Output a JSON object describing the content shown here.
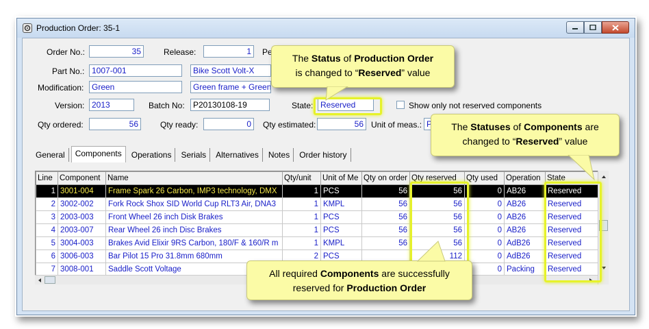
{
  "window": {
    "title": "Production Order: 35-1",
    "controls": {
      "minimize": "minimize",
      "maximize": "maximize",
      "close": "close"
    }
  },
  "form": {
    "order_no_label": "Order No.:",
    "order_no": "35",
    "release_label": "Release:",
    "release": "1",
    "period_label": "Per",
    "part_no_label": "Part No.:",
    "part_no": "1007-001",
    "part_name": "Bike Scott Volt-X",
    "modification_label": "Modification:",
    "modification": "Green",
    "modification_desc": "Green frame + Green fork",
    "version_label": "Version:",
    "version": "2013",
    "batch_no_label": "Batch No:",
    "batch_no": "P20130108-19",
    "state_label": "State:",
    "state": "Reserved",
    "show_only_label": "Show only not reserved components",
    "qty_ordered_label": "Qty ordered:",
    "qty_ordered": "56",
    "qty_ready_label": "Qty ready:",
    "qty_ready": "0",
    "qty_estimated_label": "Qty estimated:",
    "qty_estimated": "56",
    "unit_label": "Unit of meas.:",
    "unit_partial": "P"
  },
  "tabs": [
    "General",
    "Components",
    "Operations",
    "Serials",
    "Alternatives",
    "Notes",
    "Order history"
  ],
  "grid": {
    "columns": [
      "Line",
      "Component",
      "Name",
      "Qty/unit",
      "Unit of Me",
      "Qty on order",
      "Qty reserved",
      "Qty used",
      "Operation",
      "State"
    ],
    "rows": [
      [
        "1",
        "3001-004",
        "Frame Spark 26 Carbon, IMP3 technology, DMX",
        "1",
        "PCS",
        "56",
        "56",
        "0",
        "AB26",
        "Reserved"
      ],
      [
        "2",
        "3002-002",
        "Fork Rock Shox SID World Cup RLT3 Air, DNA3",
        "1",
        "KMPL",
        "56",
        "56",
        "0",
        "AB26",
        "Reserved"
      ],
      [
        "3",
        "2003-003",
        "Front Wheel 26 inch Disk Brakes",
        "1",
        "PCS",
        "56",
        "56",
        "0",
        "AB26",
        "Reserved"
      ],
      [
        "4",
        "2003-007",
        "Rear Wheel 26 inch Disc Brakes",
        "1",
        "PCS",
        "56",
        "56",
        "0",
        "AB26",
        "Reserved"
      ],
      [
        "5",
        "3004-003",
        "Brakes Avid Elixir 9RS Carbon, 180/F & 160/R m",
        "1",
        "KMPL",
        "56",
        "56",
        "0",
        "AdB26",
        "Reserved"
      ],
      [
        "6",
        "3006-003",
        "Bar Pilot 15 Pro 31.8mm 680mm",
        "2",
        "PCS",
        "",
        "112",
        "0",
        "AdB26",
        "Reserved"
      ],
      [
        "7",
        "3008-001",
        "Saddle Scott Voltage",
        "",
        "",
        "",
        "",
        "0",
        "Packing",
        "Reserved"
      ]
    ]
  },
  "callouts": {
    "status_pre": "The ",
    "status_b1": "Status",
    "status_mid": " of ",
    "status_b2": "Production Order",
    "status_line2_pre": "is changed to “",
    "status_b3": "Reserved",
    "status_line2_post": "” value",
    "comp_pre": "The ",
    "comp_b1": "Statuses",
    "comp_mid": " of ",
    "comp_b2": "Components",
    "comp_post": " are",
    "comp_line2_pre": "changed to “",
    "comp_b3": "Reserved",
    "comp_line2_post": "” value",
    "all_pre": "All required ",
    "all_b1": "Components",
    "all_mid": " are successfully",
    "all_line2_pre": "reserved for ",
    "all_b2": "Production Order"
  },
  "colors": {
    "highlight": "#e6f22a",
    "callout_bg": "#fbfba6",
    "value_text": "#1a20c8",
    "selected_state": "#f5e84a"
  }
}
